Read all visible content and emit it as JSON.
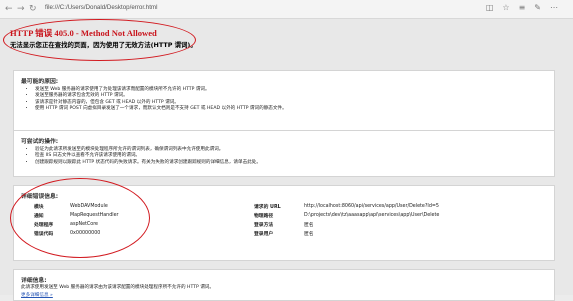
{
  "browser": {
    "url": "file:///C:/Users/Donald/Desktop/error.html",
    "back_icon": "arrow-left-icon",
    "forward_icon": "arrow-right-icon",
    "refresh_icon": "refresh-icon"
  },
  "error": {
    "title": "HTTP 错误 405.0 - Method Not Allowed",
    "subtitle": "无法显示您正在查找的页面，因为使用了无效方法(HTTP 谓词)。"
  },
  "causes": {
    "heading": "最可能的原因:",
    "items": [
      "发送至 Web 服务器的请求使用了为处理该请求而配置的模块所不允许的 HTTP 谓词。",
      "发送至服务器的请求包含无效的 HTTP 谓词。",
      "该请求是针对静态内容的，但包含 GET 或 HEAD 以外的 HTTP 谓词。",
      "使用 HTTP 谓词 POST 向虚拟目录发送了一个请求，而默认文档则是不支持 GET 或 HEAD 以外的 HTTP 谓词的静态文件。"
    ]
  },
  "actions": {
    "heading": "可尝试的操作:",
    "items": [
      "验证为此请求所发送至的模块处理程序所允许的谓词列表，确保谓词列表中允许使用此谓词。",
      "检查 IIS 日志文件以查看不允许该请求使用的谓词。",
      "创建跟踪规则以跟踪此 HTTP 状态代码的失败请求。有关为失败的请求创建跟踪规则的详细信息，请单击此处。"
    ]
  },
  "details": {
    "heading": "详细错误信息:",
    "left": [
      {
        "key": "模块",
        "value": "WebDAVModule"
      },
      {
        "key": "通知",
        "value": "MapRequestHandler"
      },
      {
        "key": "处理程序",
        "value": "aspNetCore"
      },
      {
        "key": "错误代码",
        "value": "0x00000000"
      }
    ],
    "right": [
      {
        "key": "请求的 URL",
        "value": "http://localhost:8060/api/services/app/User/Delete?Id=5"
      },
      {
        "key": "物理路径",
        "value": "D:\\projects\\dev\\tz\\aaasapp\\api\\services\\app\\User\\Delete"
      },
      {
        "key": "登录方法",
        "value": "匿名"
      },
      {
        "key": "登录用户",
        "value": "匿名"
      }
    ]
  },
  "more": {
    "heading": "详细信息:",
    "text": "此请求使用发送至 Web 服务器的请求由为该请求配置的模块处理程序所不允许的 HTTP 谓词。",
    "link": "更多详细信息 »"
  },
  "colors": {
    "error_red": "#c9141c",
    "annotation_red": "#d21a20",
    "link_blue": "#2655b5"
  }
}
